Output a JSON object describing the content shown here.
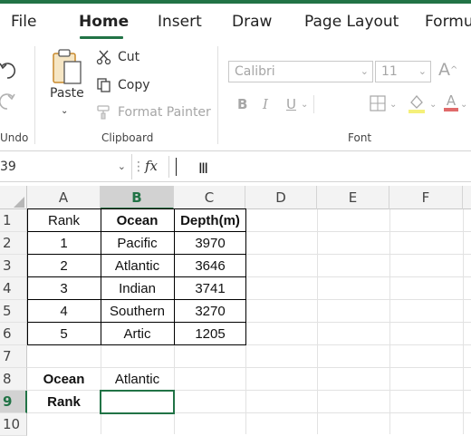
{
  "tabs": [
    "File",
    "Home",
    "Insert",
    "Draw",
    "Page Layout",
    "Formu"
  ],
  "ribbon": {
    "undo_group": "Undo",
    "clipboard": {
      "paste": "Paste",
      "cut": "Cut",
      "copy": "Copy",
      "format_painter": "Format Painter",
      "label": "Clipboard"
    },
    "font": {
      "name": "Calibri",
      "size": "11",
      "bold": "B",
      "italic": "I",
      "underline": "U",
      "grow": "A",
      "shrink": "A",
      "label": "Font"
    }
  },
  "formula_bar": {
    "name_box": "39",
    "fx": "fx",
    "value": ""
  },
  "grid": {
    "columns": [
      "A",
      "B",
      "C",
      "D",
      "E",
      "F"
    ],
    "selected_column": "B",
    "rows": [
      "1",
      "2",
      "3",
      "4",
      "5",
      "6",
      "7",
      "8",
      "9",
      "10"
    ],
    "selected_row": "9",
    "table": {
      "headers": [
        "Rank",
        "Ocean",
        "Depth(m)"
      ],
      "rows": [
        [
          "1",
          "Pacific",
          "3970"
        ],
        [
          "2",
          "Atlantic",
          "3646"
        ],
        [
          "3",
          "Indian",
          "3741"
        ],
        [
          "4",
          "Southern",
          "3270"
        ],
        [
          "5",
          "Artic",
          "1205"
        ]
      ]
    },
    "lookup": {
      "ocean_label": "Ocean",
      "ocean_value": "Atlantic",
      "rank_label": "Rank",
      "rank_value": ""
    }
  },
  "colors": {
    "accent": "#217346"
  }
}
